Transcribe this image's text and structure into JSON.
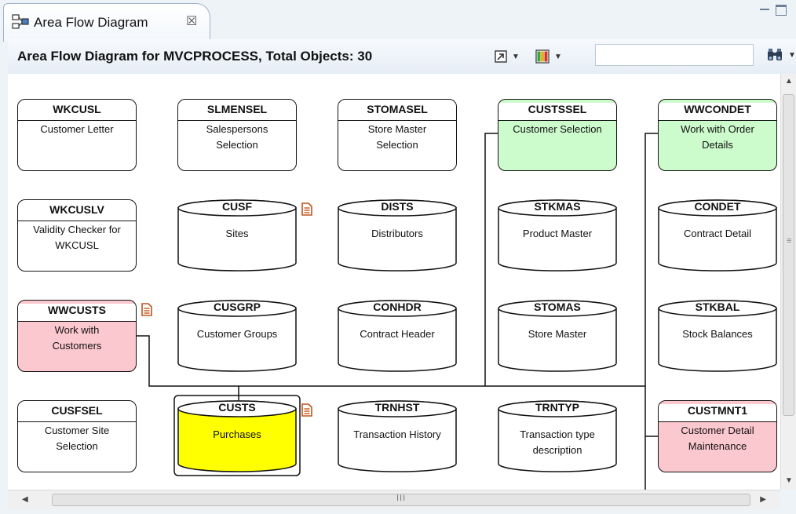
{
  "tab": {
    "title": "Area Flow Diagram",
    "close_glyph": "☒"
  },
  "header": {
    "title": "Area Flow Diagram for MVCPROCESS, Total Objects: 30"
  },
  "toolbar": {
    "search_value": ""
  },
  "colors": {
    "green": "#ccfccc",
    "pink": "#fcc8cf",
    "yellow": "#ffff00",
    "white": "#ffffff",
    "doc_icon": "#c0541b"
  },
  "scrollbar": {
    "grip_glyph": "III",
    "vgrip_glyph": "≡"
  },
  "nodes": [
    {
      "name": "WKCUSL",
      "desc": [
        "Customer Letter"
      ],
      "shape": "box",
      "fill": "white"
    },
    {
      "name": "SLMENSEL",
      "desc": [
        "Salespersons",
        "Selection"
      ],
      "shape": "box",
      "fill": "white"
    },
    {
      "name": "STOMASEL",
      "desc": [
        "Store Master",
        "Selection"
      ],
      "shape": "box",
      "fill": "white"
    },
    {
      "name": "CUSTSSEL",
      "desc": [
        "Customer Selection"
      ],
      "shape": "box",
      "fill": "green"
    },
    {
      "name": "WWCONDET",
      "desc": [
        "Work with Order",
        "Details"
      ],
      "shape": "box",
      "fill": "green"
    },
    {
      "name": "WKCUSLV",
      "desc": [
        "Validity Checker for",
        "WKCUSL"
      ],
      "shape": "box",
      "fill": "white"
    },
    {
      "name": "CUSF",
      "desc": [
        "Sites"
      ],
      "shape": "cyl",
      "fill": "white",
      "doc": true
    },
    {
      "name": "DISTS",
      "desc": [
        "Distributors"
      ],
      "shape": "cyl",
      "fill": "white"
    },
    {
      "name": "STKMAS",
      "desc": [
        "Product Master"
      ],
      "shape": "cyl",
      "fill": "white"
    },
    {
      "name": "CONDET",
      "desc": [
        "Contract Detail"
      ],
      "shape": "cyl",
      "fill": "white"
    },
    {
      "name": "WWCUSTS",
      "desc": [
        "Work with",
        "Customers"
      ],
      "shape": "box",
      "fill": "pink",
      "doc": true
    },
    {
      "name": "CUSGRP",
      "desc": [
        "Customer Groups"
      ],
      "shape": "cyl",
      "fill": "white"
    },
    {
      "name": "CONHDR",
      "desc": [
        "Contract Header"
      ],
      "shape": "cyl",
      "fill": "white"
    },
    {
      "name": "STOMAS",
      "desc": [
        "Store Master"
      ],
      "shape": "cyl",
      "fill": "white"
    },
    {
      "name": "STKBAL",
      "desc": [
        "Stock Balances"
      ],
      "shape": "cyl",
      "fill": "white"
    },
    {
      "name": "CUSFSEL",
      "desc": [
        "Customer Site",
        "Selection"
      ],
      "shape": "box",
      "fill": "white"
    },
    {
      "name": "CUSTS",
      "desc": [
        "Purchases"
      ],
      "shape": "cyl",
      "fill": "yellow",
      "doc": true,
      "selected": true
    },
    {
      "name": "TRNHST",
      "desc": [
        "Transaction History"
      ],
      "shape": "cyl",
      "fill": "white"
    },
    {
      "name": "TRNTYP",
      "desc": [
        "Transaction type",
        "description"
      ],
      "shape": "cyl",
      "fill": "white"
    },
    {
      "name": "CUSTMNT1",
      "desc": [
        "Customer Detail",
        "Maintenance"
      ],
      "shape": "box",
      "fill": "pink"
    }
  ]
}
